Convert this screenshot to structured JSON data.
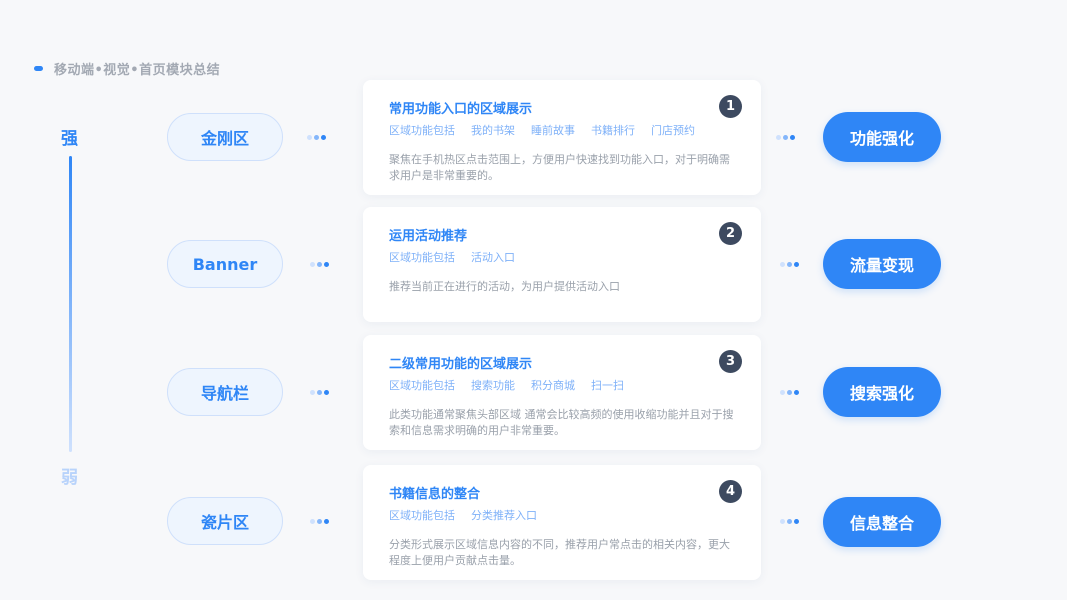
{
  "header": {
    "title": "移动端•视觉•首页模块总结"
  },
  "axis": {
    "strong": "强",
    "weak": "弱"
  },
  "rows": [
    {
      "left": "金刚区",
      "right": "功能强化",
      "num": "1",
      "title": "常用功能入口的区域展示",
      "tags": [
        "区域功能包括",
        "我的书架",
        "睡前故事",
        "书籍排行",
        "门店预约"
      ],
      "desc": "聚焦在手机热区点击范围上，方便用户快速找到功能入口，对于明确需求用户是非常重要的。"
    },
    {
      "left": "Banner",
      "right": "流量变现",
      "num": "2",
      "title": "运用活动推荐",
      "tags": [
        "区域功能包括",
        "活动入口"
      ],
      "desc": "推荐当前正在进行的活动，为用户提供活动入口"
    },
    {
      "left": "导航栏",
      "right": "搜索强化",
      "num": "3",
      "title": "二级常用功能的区域展示",
      "tags": [
        "区域功能包括",
        "搜索功能",
        "积分商城",
        "扫一扫"
      ],
      "desc": "此类功能通常聚焦头部区域 通常会比较高频的使用收缩功能并且对于搜索和信息需求明确的用户非常重要。"
    },
    {
      "left": "瓷片区",
      "right": "信息整合",
      "num": "4",
      "title": "书籍信息的整合",
      "tags": [
        "区域功能包括",
        "分类推荐入口"
      ],
      "desc": "分类形式展示区域信息内容的不同，推荐用户常点击的相关内容，更大程度上便用户贡献点击量。"
    }
  ],
  "colors": {
    "accent": "#2f86f6",
    "badge": "#3d4a60",
    "muted": "#9aa1ab"
  }
}
